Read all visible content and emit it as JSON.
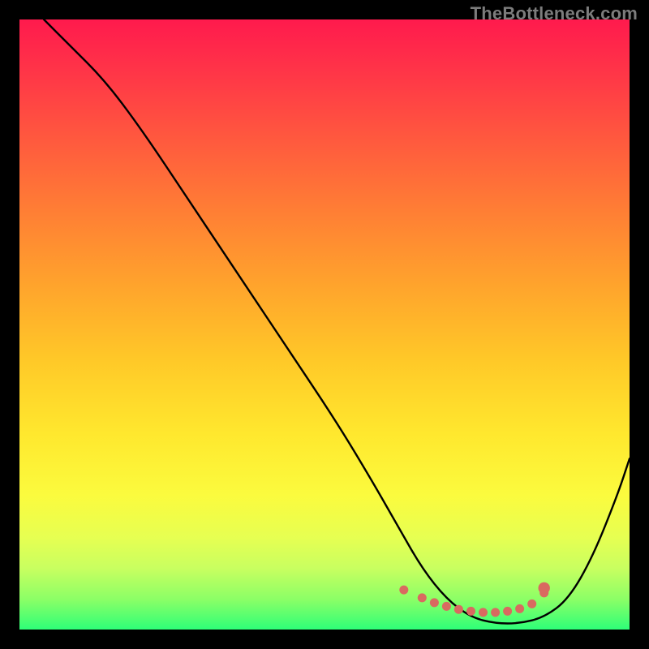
{
  "watermark": "TheBottleneck.com",
  "chart_data": {
    "type": "line",
    "title": "",
    "xlabel": "",
    "ylabel": "",
    "xlim": [
      0,
      100
    ],
    "ylim": [
      0,
      100
    ],
    "grid": false,
    "series": [
      {
        "name": "bottleneck-curve",
        "x": [
          4,
          8,
          14,
          20,
          28,
          36,
          44,
          52,
          58,
          62,
          66,
          70,
          74,
          78,
          82,
          86,
          90,
          94,
          98,
          100
        ],
        "y": [
          100,
          96,
          90,
          82,
          70,
          58,
          46,
          34,
          24,
          17,
          10,
          5,
          2,
          1,
          1,
          2,
          5,
          12,
          22,
          28
        ]
      }
    ],
    "highlight": {
      "name": "basin-markers",
      "color": "#d96a60",
      "x": [
        63,
        66,
        68,
        70,
        72,
        74,
        76,
        78,
        80,
        82,
        84,
        86
      ],
      "y": [
        6.5,
        5.2,
        4.4,
        3.8,
        3.3,
        3.0,
        2.8,
        2.8,
        3.0,
        3.4,
        4.2,
        6.0
      ]
    },
    "highlight_point": {
      "x": 86,
      "y": 6.0,
      "r": 1.2,
      "color": "#d96a60"
    },
    "background_gradient": {
      "top": "#ff1a4d",
      "mid": "#ffe82e",
      "bottom": "#2eff78"
    }
  }
}
